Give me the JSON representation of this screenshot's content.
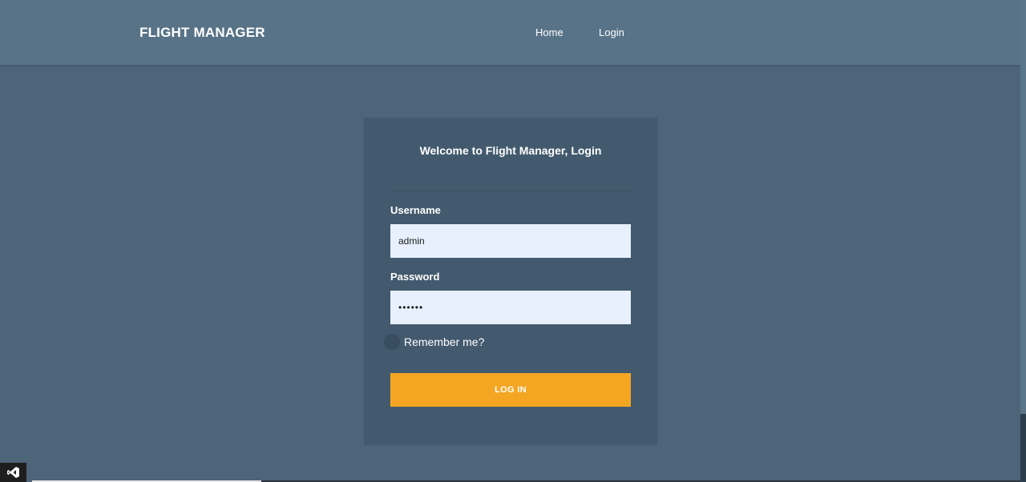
{
  "header": {
    "brand": "FLIGHT MANAGER",
    "nav": [
      {
        "label": "Home"
      },
      {
        "label": "Login"
      }
    ]
  },
  "login_card": {
    "title": "Welcome to Flight Manager, Login",
    "username_label": "Username",
    "username_value": "admin",
    "password_label": "Password",
    "password_value": "••••••",
    "remember_label": "Remember me?",
    "remember_checked": false,
    "submit_label": "LOG IN"
  },
  "colors": {
    "page_bg": "#4e6479",
    "navbar_bg": "#587387",
    "card_bg": "#435a6e",
    "input_bg": "#e8f0fe",
    "accent": "#f4a623"
  },
  "icons": {
    "devtools_badge": "visual-studio-icon"
  }
}
